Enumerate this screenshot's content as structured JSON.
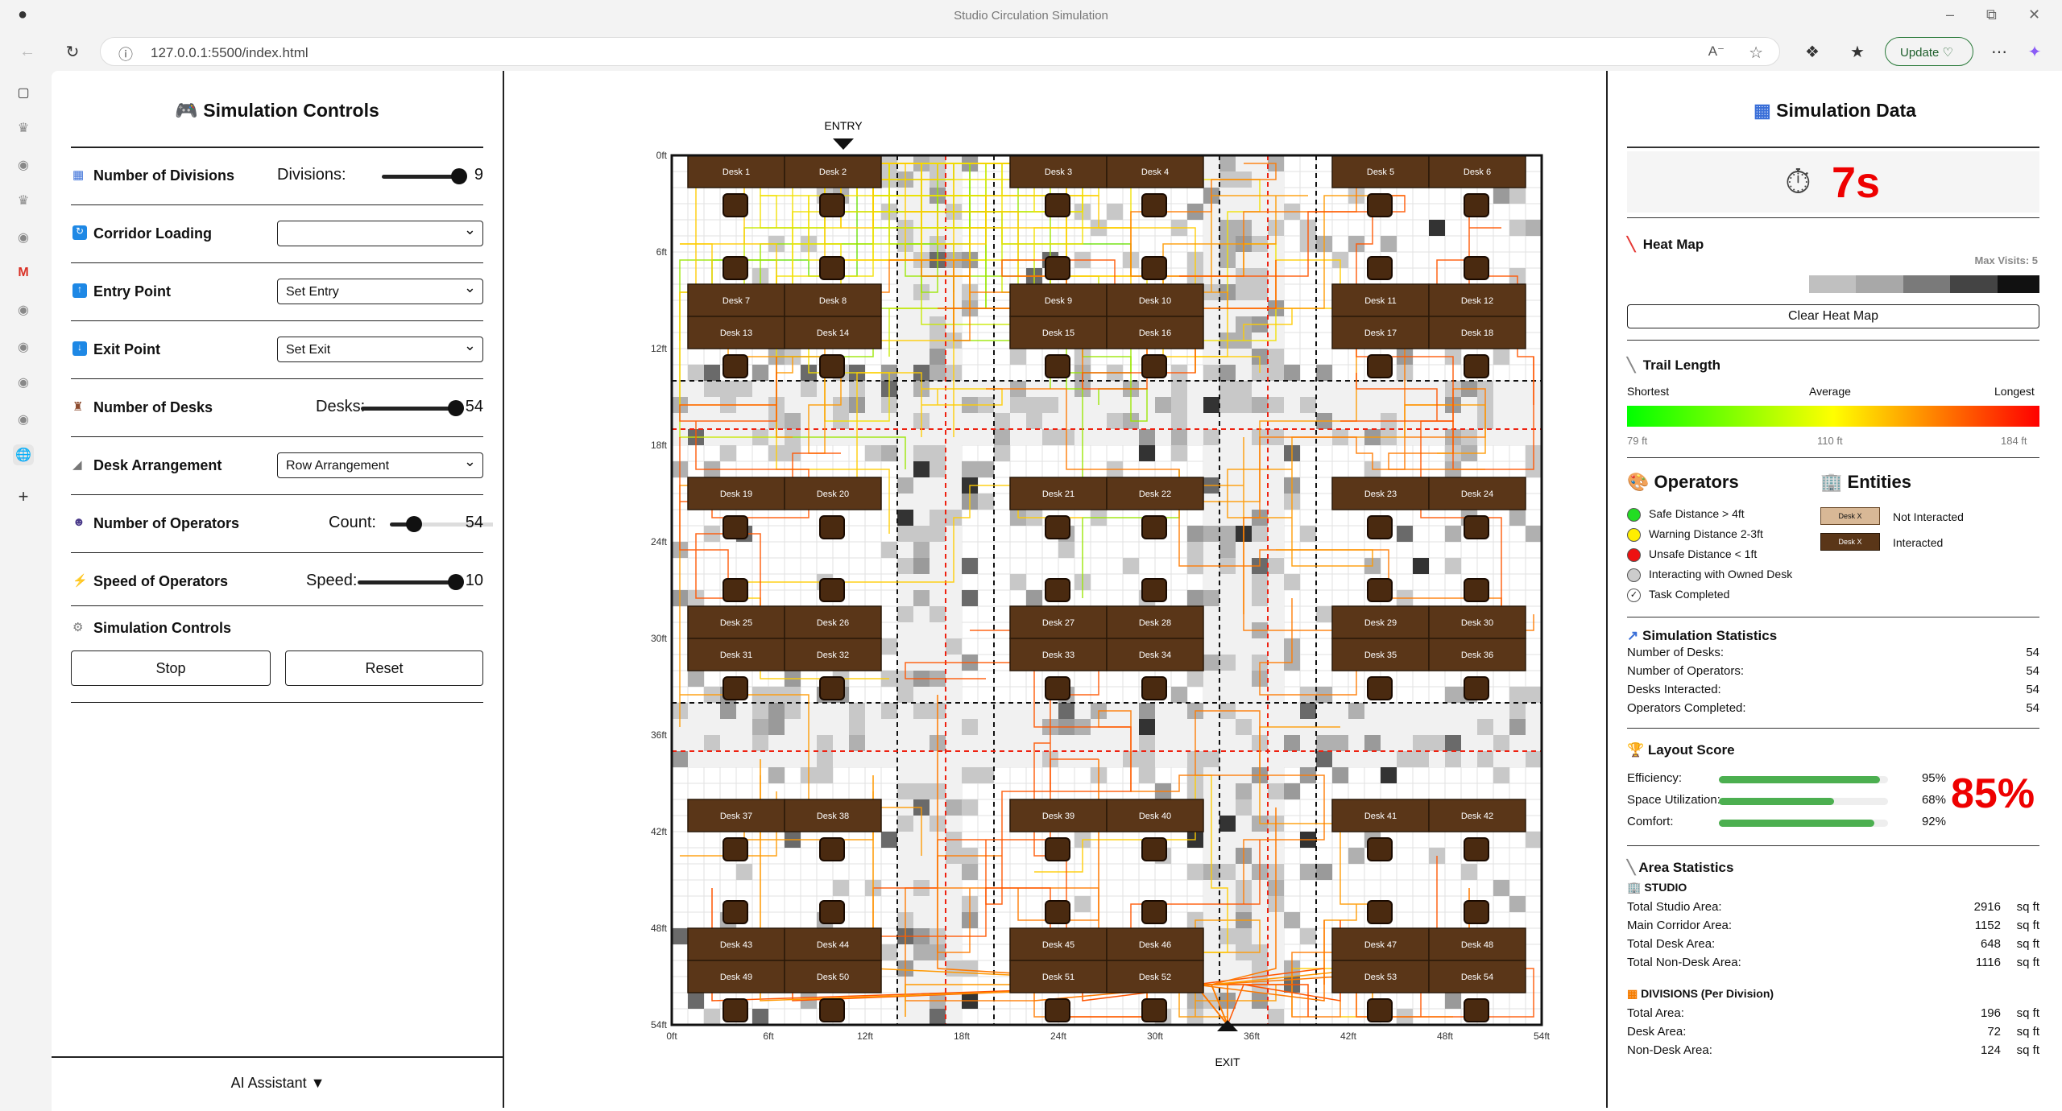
{
  "browser": {
    "title": "Studio Circulation Simulation",
    "url": "127.0.0.1:5500/index.html",
    "update_label": "Update"
  },
  "left": {
    "title": "Simulation Controls",
    "divisions": {
      "label": "Number of Divisions",
      "sub": "Divisions:",
      "value": "9",
      "fraction": 1.0
    },
    "corridor": {
      "label": "Corridor Loading",
      "value": ""
    },
    "entry": {
      "label": "Entry Point",
      "value": "Set Entry"
    },
    "exit": {
      "label": "Exit Point",
      "value": "Set Exit"
    },
    "desks": {
      "label": "Number of Desks",
      "sub": "Desks:",
      "value": "54",
      "fraction": 1.0
    },
    "arrangement": {
      "label": "Desk Arrangement",
      "value": "Row Arrangement"
    },
    "operators": {
      "label": "Number of Operators",
      "sub": "Count:",
      "value": "54",
      "fraction": 0.21
    },
    "speed": {
      "label": "Speed of Operators",
      "sub": "Speed:",
      "value": "10",
      "fraction": 1.0
    },
    "controls": {
      "label": "Simulation Controls",
      "stop": "Stop",
      "reset": "Reset"
    },
    "ai": "AI Assistant ▼"
  },
  "floor": {
    "entry_label": "ENTRY",
    "exit_label": "EXIT",
    "y_ticks": [
      "0ft",
      "6ft",
      "12ft",
      "18ft",
      "24ft",
      "30ft",
      "36ft",
      "42ft",
      "48ft",
      "54ft"
    ],
    "x_ticks": [
      "0ft",
      "6ft",
      "12ft",
      "18ft",
      "24ft",
      "30ft",
      "36ft",
      "42ft",
      "48ft",
      "54ft"
    ]
  },
  "right": {
    "title": "Simulation Data",
    "timer": "7s",
    "heatmap": {
      "label": "Heat Map",
      "max_visits": "Max Visits: 5",
      "clear": "Clear Heat Map"
    },
    "trail": {
      "label": "Trail Length",
      "shortest": "Shortest",
      "average": "Average",
      "longest": "Longest",
      "min": "79 ft",
      "mid": "110 ft",
      "max": "184 ft"
    },
    "operators": {
      "title": "Operators",
      "items": [
        {
          "label": "Safe Distance > 4ft",
          "color": "#22dd22"
        },
        {
          "label": "Warning Distance 2-3ft",
          "color": "#ffee00"
        },
        {
          "label": "Unsafe Distance < 1ft",
          "color": "#ee1111"
        },
        {
          "label": "Interacting with Owned Desk",
          "color": "#cccccc"
        },
        {
          "label": "Task Completed",
          "color": "#ffffff"
        }
      ]
    },
    "entities": {
      "title": "Entities",
      "not_interacted": "Not Interacted",
      "interacted": "Interacted",
      "desk_tag": "Desk X"
    },
    "stats": {
      "title": "Simulation Statistics",
      "rows": [
        {
          "k": "Number of Desks:",
          "v": "54"
        },
        {
          "k": "Number of Operators:",
          "v": "54"
        },
        {
          "k": "Desks Interacted:",
          "v": "54"
        },
        {
          "k": "Operators Completed:",
          "v": "54"
        }
      ]
    },
    "score": {
      "title": "Layout Score",
      "total": "85%",
      "rows": [
        {
          "k": "Efficiency:",
          "v": "95%",
          "f": 0.95
        },
        {
          "k": "Space Utilization:",
          "v": "68%",
          "f": 0.68
        },
        {
          "k": "Comfort:",
          "v": "92%",
          "f": 0.92
        }
      ]
    },
    "area": {
      "title": "Area Statistics",
      "studio": "STUDIO",
      "studio_rows": [
        {
          "k": "Total Studio Area:",
          "v": "2916",
          "u": "sq ft"
        },
        {
          "k": "Main Corridor Area:",
          "v": "1152",
          "u": "sq ft"
        },
        {
          "k": "Total Desk Area:",
          "v": "648",
          "u": "sq ft"
        },
        {
          "k": "Total Non-Desk Area:",
          "v": "1116",
          "u": "sq ft"
        }
      ],
      "divisions": "DIVISIONS (Per Division)",
      "div_rows": [
        {
          "k": "Total Area:",
          "v": "196",
          "u": "sq ft"
        },
        {
          "k": "Desk Area:",
          "v": "72",
          "u": "sq ft"
        },
        {
          "k": "Non-Desk Area:",
          "v": "124",
          "u": "sq ft"
        }
      ]
    }
  }
}
